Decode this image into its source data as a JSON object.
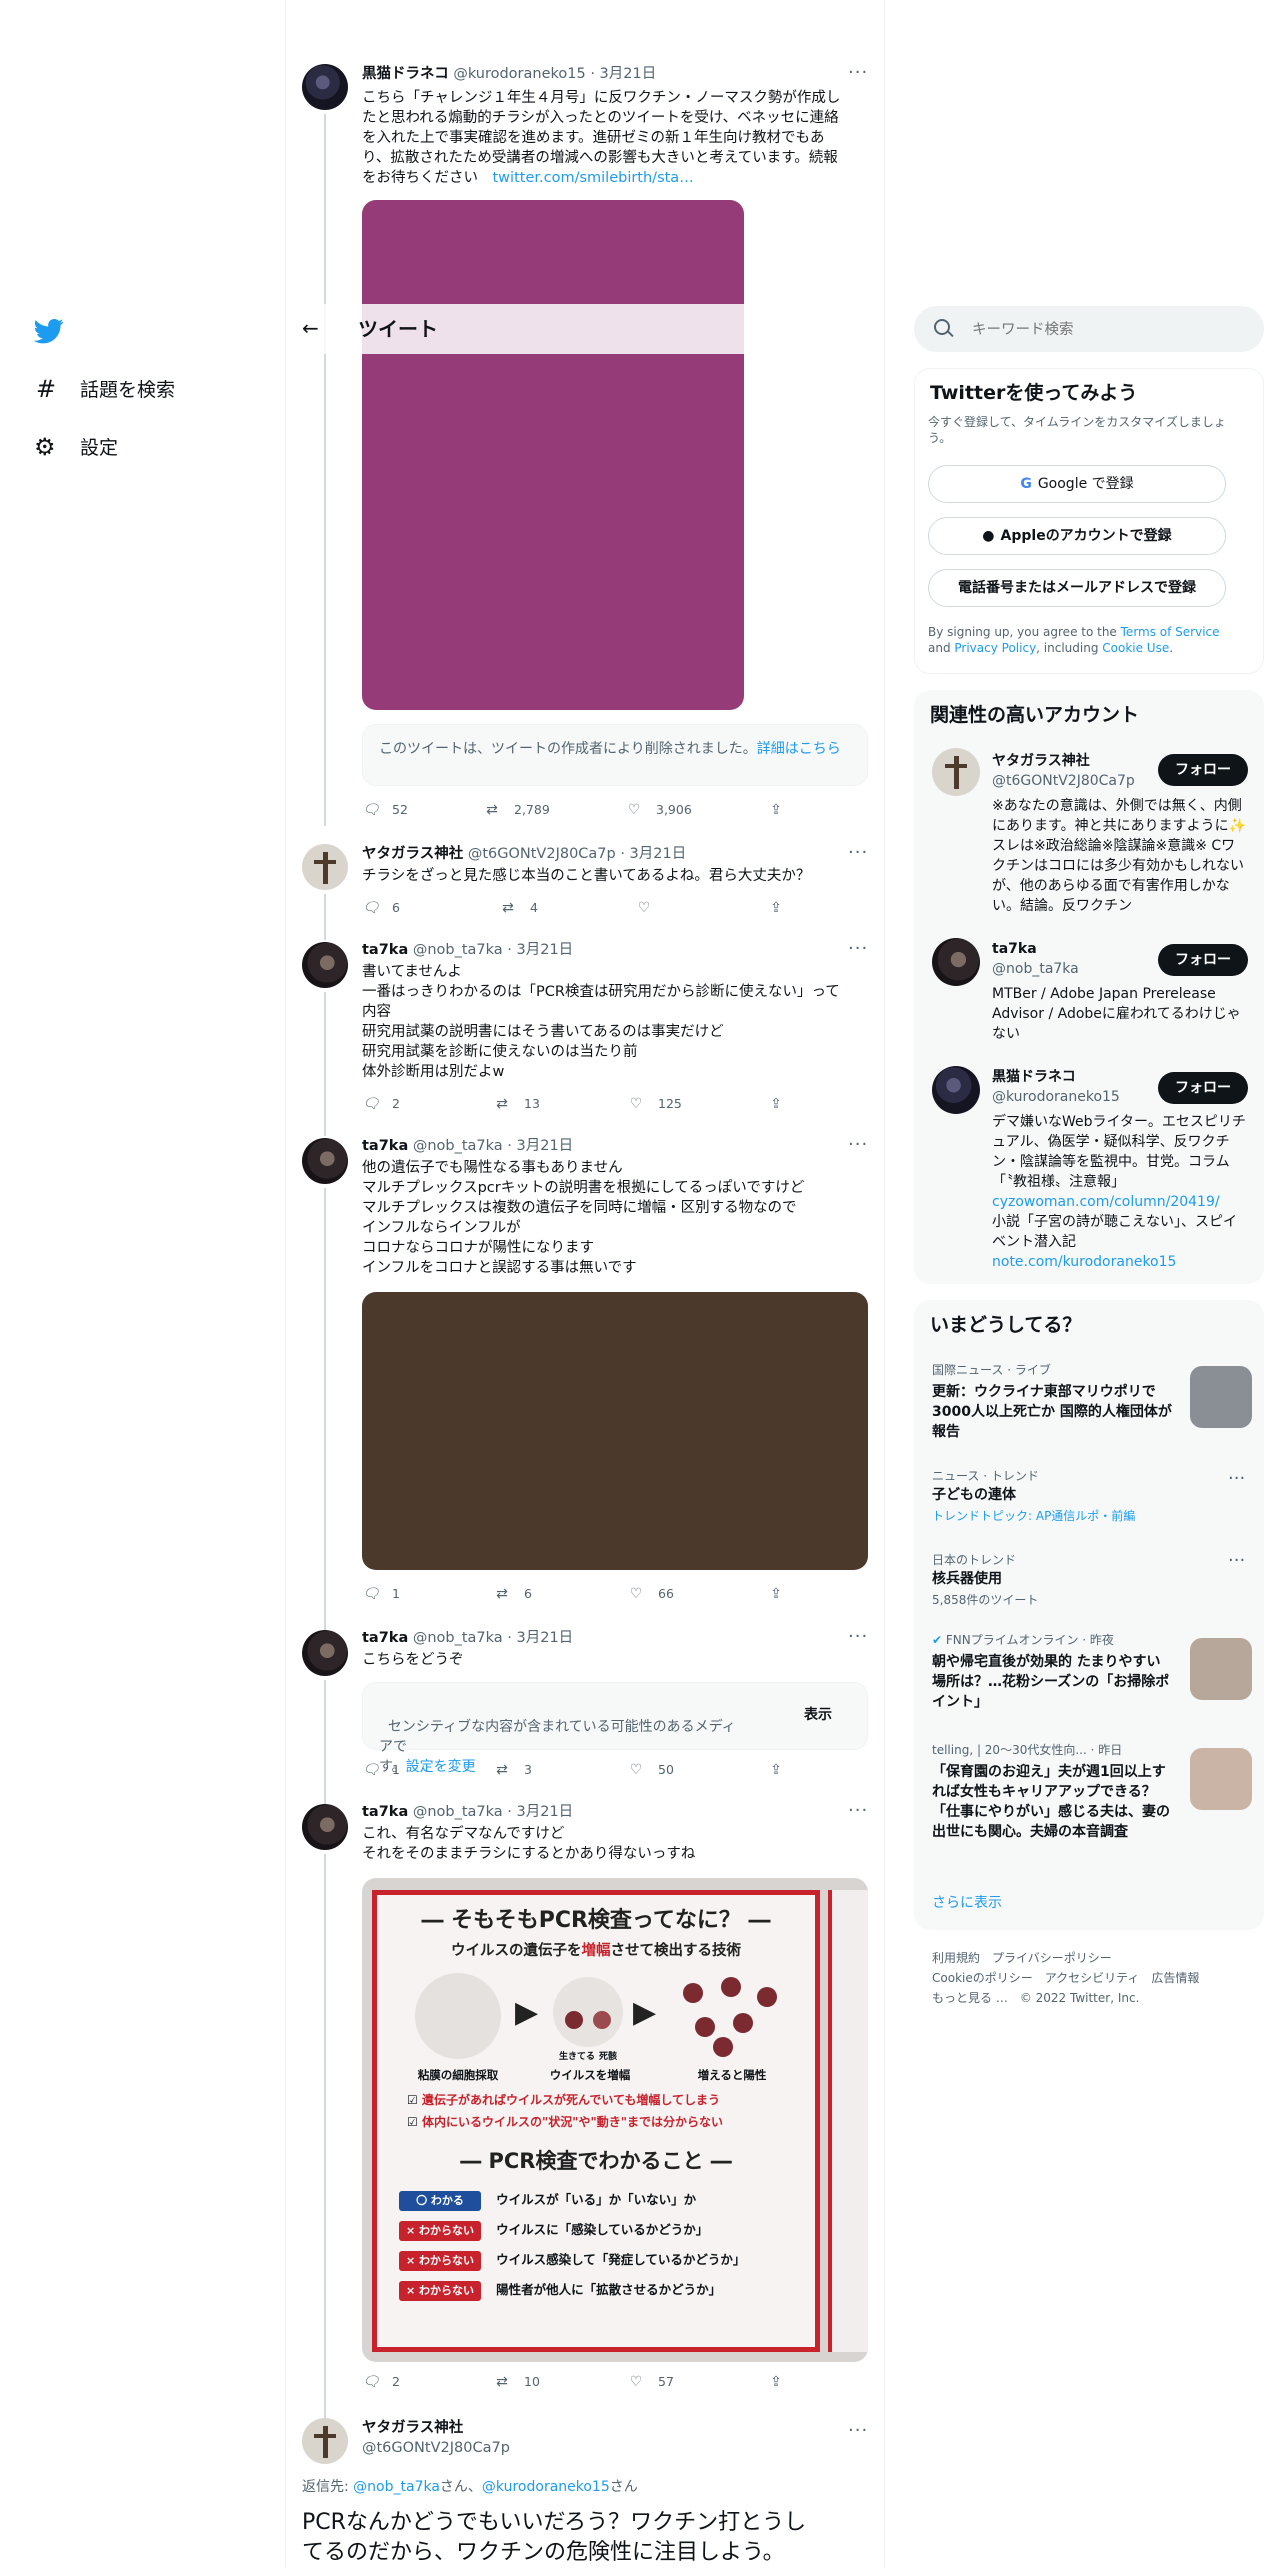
{
  "nav": {
    "explore_label": "話題を検索",
    "settings_label": "設定",
    "hash_glyph": "#",
    "gear_glyph": "⚙"
  },
  "header": {
    "back_glyph": "←",
    "title": "ツイート"
  },
  "search": {
    "placeholder": "キーワード検索",
    "icon_glyph": "⌕"
  },
  "tweets": [
    {
      "name": "黒猫ドラネコ",
      "meta": "@kurodoraneko15 · 3月21日",
      "text": "こちら「チャレンジ１年生４月号」に反ワクチン・ノーマスク勢が作成し\nたと思われる煽動的チラシが入ったとのツイートを受け、ベネッセに連絡\nを入れた上で事実確認を進めます。進研ゼミの新１年生向け教材でもあ\nり、拡散されたため受講者の増減への影響も大きいと考えています。続報\nをお待ちください",
      "link": "twitter.com/smilebirth/sta…",
      "notice_text": "このツイートは、ツイートの作成者により削除されました。",
      "notice_link": "詳細はこちら",
      "replies": "52",
      "retweets": "2,789",
      "likes": "3,906"
    },
    {
      "name": "ヤタガラス神社",
      "meta": "@t6GONtV2J80Ca7p · 3月21日",
      "text": "チラシをざっと見た感じ本当のこと書いてあるよね。君ら大丈夫か？",
      "replies": "6",
      "retweets": "4",
      "likes": ""
    },
    {
      "name": "ta7ka",
      "meta": "@nob_ta7ka · 3月21日",
      "text": "書いてませんよ\n一番はっきりわかるのは「PCR検査は研究用だから診断に使えない」って\n内容\n研究用試薬の説明書にはそう書いてあるのは事実だけど\n研究用試薬を診断に使えないのは当たり前\n体外診断用は別だよw",
      "replies": "2",
      "retweets": "13",
      "likes": "125"
    },
    {
      "name": "ta7ka",
      "meta": "@nob_ta7ka · 3月21日",
      "text": "他の遺伝子でも陽性なる事もありません\nマルチプレックスpcrキットの説明書を根拠にしてるっぽいですけど\nマルチプレックスは複数の遺伝子を同時に増幅・区別する物なので\nインフルならインフルが\nコロナならコロナが陽性になります\nインフルをコロナと誤認する事は無いです",
      "replies": "1",
      "retweets": "6",
      "likes": "66"
    },
    {
      "name": "ta7ka",
      "meta": "@nob_ta7ka · 3月21日",
      "text": "こちらをどうぞ",
      "notice_text": "センシティブな内容が含まれている可能性のあるメディアで\nす。",
      "notice_link": "設定を変更",
      "show_label": "表示",
      "replies": "1",
      "retweets": "3",
      "likes": "50"
    },
    {
      "name": "ta7ka",
      "meta": "@nob_ta7ka · 3月21日",
      "text": "これ、有名なデマなんですけど\nそれをそのままチラシにするとかあり得ないっすね",
      "replies": "2",
      "retweets": "10",
      "likes": "57"
    }
  ],
  "flyer": {
    "title": "― そもそもPCR検査ってなに？ ―",
    "subtitle_pre": "ウイルスの遺伝子を",
    "subtitle_hl": "増幅",
    "subtitle_post": "させて検出する技術",
    "step1": "粘膜の細胞採取",
    "step2": "ウイルスを増幅",
    "step3": "増えると陽性",
    "label_alive": "生きてる",
    "label_dead": "死骸",
    "check1": "遺伝子があればウイルスが死んでいても増幅してしまう",
    "check2": "体内にいるウイルスの\"状況\"や\"動き\"までは分からない",
    "section_title": "― PCR検査でわかること ―",
    "rows": [
      {
        "tag": "〇 わかる",
        "text": "ウイルスが「いる」か「いない」か"
      },
      {
        "tag": "× わからない",
        "text": "ウイルスに「感染しているかどうか」"
      },
      {
        "tag": "× わからない",
        "text": "ウイルス感染して「発症しているかどうか」"
      },
      {
        "tag": "× わからない",
        "text": "陽性者が他人に「拡散させるかどうか」"
      }
    ]
  },
  "main_tweet": {
    "name": "ヤタガラス神社",
    "handle": "@t6GONtV2J80Ca7p",
    "reply_prefix": "返信先: ",
    "reply_user1": "@nob_ta7ka",
    "reply_mid": "さん、",
    "reply_user2": "@kurodoraneko15",
    "reply_suffix": "さん",
    "text": "PCRなんかどうでもいいだろう？ワクチン打とうし\nてるのだから、ワクチンの危険性に注目しよう。"
  },
  "signup": {
    "title": "Twitterを使ってみよう",
    "subtitle": "今すぐ登録して、タイムラインをカスタマイズしましょう。",
    "google_label": "Google で登録",
    "apple_label": "Appleのアカウントで登録",
    "phone_label": "電話番号またはメールアドレスで登録",
    "terms_pre": "By signing up, you agree to the ",
    "terms_link": "Terms of Service",
    "terms_mid": " and ",
    "privacy_link": "Privacy Policy",
    "terms_mid2": ", including ",
    "cookie_link": "Cookie Use",
    "terms_end": "."
  },
  "relevant": {
    "title": "関連性の高いアカウント",
    "follow_label": "フォロー",
    "accounts": [
      {
        "name": "ヤタガラス神社",
        "handle": "@t6GONtV2J80Ca7p",
        "bio": "※あなたの意識は、外側では無く、内側にあります。神と共にありますように✨ スレは※政治総論※陰謀論※意識※ Cワクチンはコロには多少有効かもしれないが、他のあらゆる面で有害作用しかない。結論。反ワクチン"
      },
      {
        "name": "ta7ka",
        "handle": "@nob_ta7ka",
        "bio": "MTBer / Adobe Japan Prerelease Advisor / Adobeに雇われてるわけじゃない"
      },
      {
        "name": "黒猫ドラネコ",
        "handle": "@kurodoraneko15",
        "bio": "デマ嫌いなWebライター。エセスピリチュアル、偽医学・疑似科学、反ワクチン・陰謀論等を監視中。甘党。コラム「〝教祖様〟注意報」",
        "bio_link": "cyzowoman.com/column/20419/",
        "bio2": "小説「子宮の詩が聴こえない」、スピイベント潜入記",
        "bio_link2": "note.com/kurodoraneko15"
      }
    ]
  },
  "trends": {
    "title": "いまどうしてる？",
    "items": [
      {
        "meta": "国際ニュース · ライブ",
        "title": "更新：ウクライナ東部マリウポリで3000人以上死亡か 国際的人権団体が報告"
      },
      {
        "meta": "ニュース · トレンド",
        "title": "子どもの連体",
        "sub": "トレンドトピック: AP通信ルポ・前編"
      },
      {
        "meta": "日本のトレンド",
        "title": "核兵器使用",
        "sub": "5,858件のツイート"
      },
      {
        "meta": "FNNプライムオンライン · 昨夜",
        "title": "朝や帰宅直後が効果的 たまりやすい場所は？…花粉シーズンの「お掃除ポイント」"
      },
      {
        "meta": "telling, | 20～30代女性向... · 昨日",
        "title": "「保育園のお迎え」夫が週1回以上すれば女性もキャリアアップできる？「仕事にやりがい」感じる夫は、妻の出世にも関心。夫婦の本音調査"
      }
    ],
    "show_more": "さらに表示"
  },
  "footer": {
    "line1": "利用規約　プライバシーポリシー",
    "line2": "Cookieのポリシー　アクセシビリティ　広告情報",
    "line3": "もっと見る …　© 2022 Twitter, Inc."
  },
  "colors": {
    "accent": "#1d9bf0",
    "image1": "#943b78",
    "image2": "#4b3a2c",
    "flyer_red": "#c8232c",
    "flyer_blue": "#1e4e9c"
  }
}
